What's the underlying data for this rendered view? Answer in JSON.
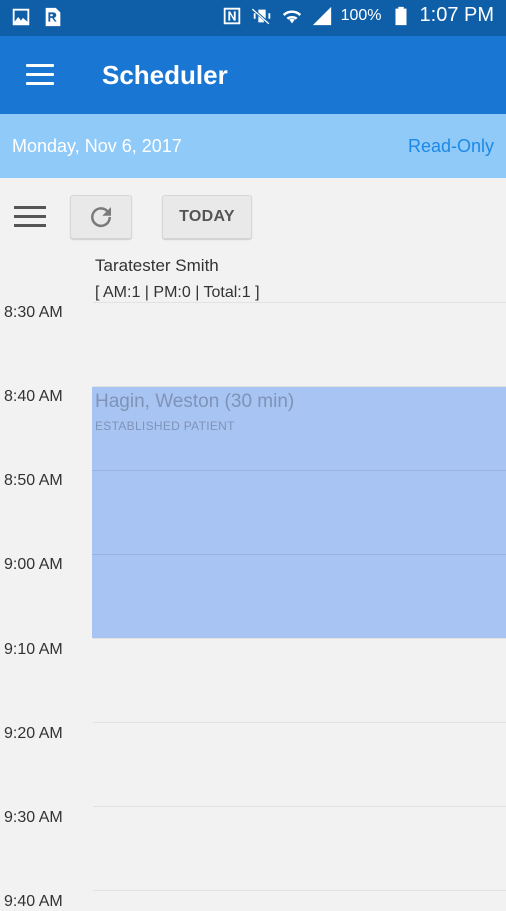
{
  "status_bar": {
    "battery": "100%",
    "time": "1:07 PM",
    "icons": [
      "gallery-icon",
      "prescription-icon",
      "nfc-icon",
      "vibrate-mute-icon",
      "wifi-icon",
      "signal-icon",
      "battery-icon"
    ]
  },
  "app_bar": {
    "title": "Scheduler",
    "menu_icon": "hamburger-icon",
    "color": "#1976d2"
  },
  "date_bar": {
    "date": "Monday, Nov 6, 2017",
    "mode": "Read-Only"
  },
  "toolbar": {
    "menu_icon": "list-menu-icon",
    "refresh_icon": "refresh-icon",
    "today_label": "TODAY"
  },
  "provider": {
    "name": "Taratester Smith",
    "counts": "[ AM:1 | PM:0 | Total:1 ]"
  },
  "time_slots": [
    "8:30 AM",
    "8:40 AM",
    "8:50 AM",
    "9:00 AM",
    "9:10 AM",
    "9:20 AM",
    "9:30 AM",
    "9:40 AM"
  ],
  "appointment": {
    "name": "Hagin, Weston (30 min)",
    "type": "ESTABLISHED PATIENT",
    "start": "8:40 AM",
    "duration_min": 30,
    "color": "#a8c4f3"
  }
}
